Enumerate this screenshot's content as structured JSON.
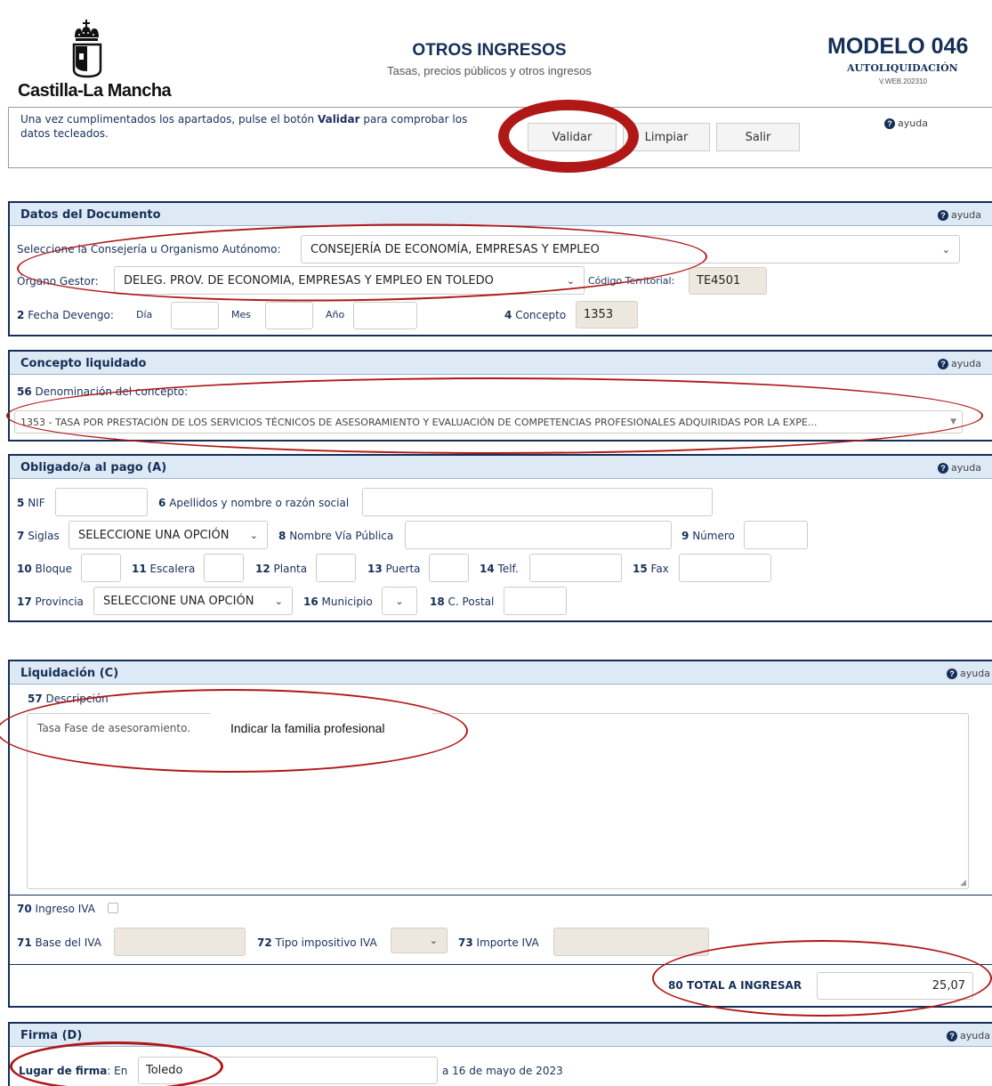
{
  "header": {
    "logo_text": "Castilla-La Mancha",
    "title": "OTROS INGRESOS",
    "subtitle": "Tasas, precios públicos y otros ingresos",
    "modelo": "MODELO 046",
    "autoliquidacion": "AUTOLIQUIDACIÓN",
    "version": "V.WEB.202310"
  },
  "intro": {
    "text_before": "Una vez cumplimentados los apartados, pulse el botón ",
    "text_bold": "Validar",
    "text_after": " para comprobar los datos tecleados.",
    "validar_label": "Validar",
    "limpiar_label": "Limpiar",
    "salir_label": "Salir"
  },
  "help_label": "ayuda",
  "documento": {
    "title": "Datos del Documento",
    "consejeria_label": "Seleccione la Consejería u Organismo Autónomo:",
    "consejeria_value": "CONSEJERÍA DE ECONOMÍA, EMPRESAS Y EMPLEO",
    "organo_label": "Órgano Gestor:",
    "organo_value": "DELEG. PROV. DE ECONOMIA, EMPRESAS Y EMPLEO EN TOLEDO",
    "codigo_label": "Código Territorial:",
    "codigo_value": "TE4501",
    "fecha_num": "2",
    "fecha_label": "Fecha Devengo:",
    "dia_label": "Día",
    "mes_label": "Mes",
    "anio_label": "Año",
    "concepto_num": "4",
    "concepto_label": "Concepto",
    "concepto_value": "1353"
  },
  "concepto": {
    "title": "Concepto liquidado",
    "denom_num": "56",
    "denom_label": "Denominación del concepto:",
    "denom_value": "1353 - TASA POR PRESTACIÓN DE LOS SERVICIOS TÉCNICOS DE ASESORAMIENTO Y EVALUACIÓN DE COMPETENCIAS PROFESIONALES ADQUIRIDAS POR LA EXPE..."
  },
  "obligado": {
    "title": "Obligado/a al pago (A)",
    "nif_num": "5",
    "nif_label": "NIF",
    "apellidos_num": "6",
    "apellidos_label": "Apellidos y nombre o razón social",
    "siglas_num": "7",
    "siglas_label": "Siglas",
    "siglas_value": "SELECCIONE UNA OPCIÓN",
    "via_num": "8",
    "via_label": "Nombre Vía Pública",
    "numero_num": "9",
    "numero_label": "Número",
    "bloque_num": "10",
    "bloque_label": "Bloque",
    "escalera_num": "11",
    "escalera_label": "Escalera",
    "planta_num": "12",
    "planta_label": "Planta",
    "puerta_num": "13",
    "puerta_label": "Puerta",
    "telf_num": "14",
    "telf_label": "Telf.",
    "fax_num": "15",
    "fax_label": "Fax",
    "provincia_num": "17",
    "provincia_label": "Provincia",
    "provincia_value": "SELECCIONE UNA OPCIÓN",
    "municipio_num": "16",
    "municipio_label": "Municipio",
    "cpostal_num": "18",
    "cpostal_label": "C. Postal"
  },
  "liquidacion": {
    "title": "Liquidación (C)",
    "desc_num": "57",
    "desc_label": "Descripción",
    "desc_value": "Tasa Fase de asesoramiento.",
    "annotation": "Indicar la familia profesional",
    "iva_num": "70",
    "iva_label": "Ingreso IVA",
    "base_num": "71",
    "base_label": "Base del IVA",
    "tipo_num": "72",
    "tipo_label": "Tipo impositivo IVA",
    "importe_num": "73",
    "importe_label": "Importe IVA",
    "total_num": "80",
    "total_label": "TOTAL A INGRESAR",
    "total_value": "25,07"
  },
  "firma": {
    "title": "Firma (D)",
    "lugar_label": "Lugar de firma",
    "en_label": ": En",
    "lugar_value": "Toledo",
    "fecha_text": "a 16 de mayo de 2023"
  },
  "colors": {
    "brand": "#152f57",
    "section_bg": "#dde9f5",
    "annotation": "#b01818"
  },
  "icons": [
    "crown-logo-icon",
    "help-icon",
    "chevron-down-icon"
  ]
}
